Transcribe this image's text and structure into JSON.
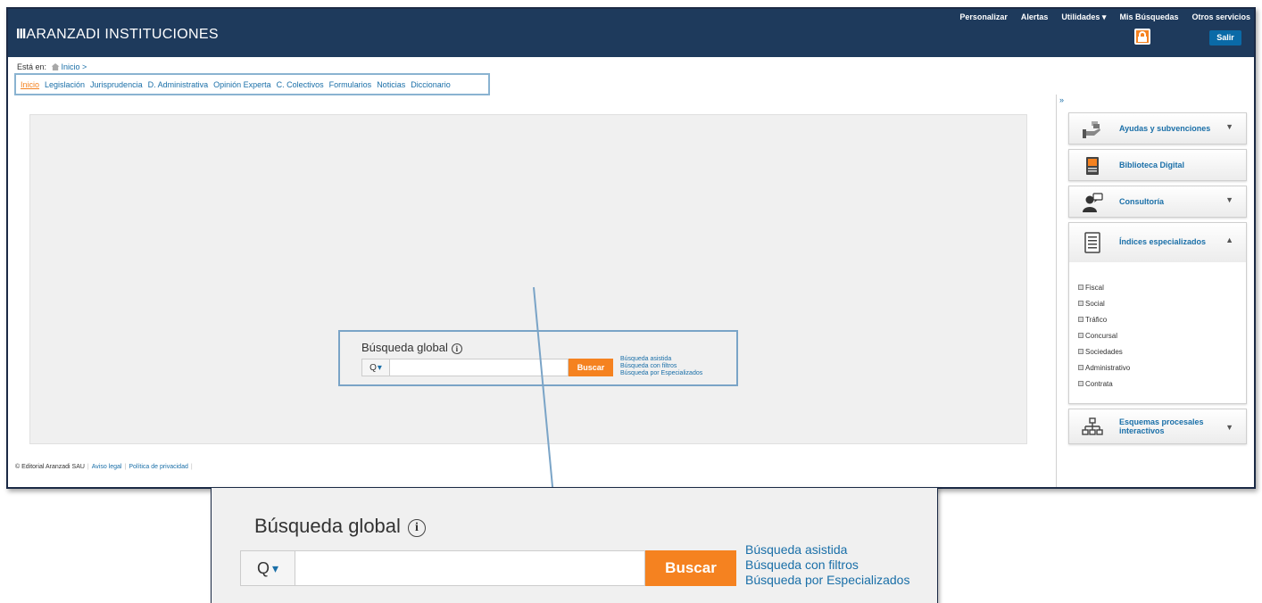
{
  "app": {
    "brand_bars": "III",
    "brand_name": "ARANZADI INSTITUCIONES"
  },
  "topnav": {
    "items": [
      "Personalizar",
      "Alertas",
      "Utilidades ▾",
      "Mis Búsquedas",
      "Otros servicios"
    ],
    "exit_label": "Salir"
  },
  "breadcrumb": {
    "prefix": "Está en:",
    "home": "Inicio >"
  },
  "mainnav": {
    "items": [
      "Inicio",
      "Legislación",
      "Jurisprudencia",
      "D. Administrativa",
      "Opinión Experta",
      "C. Colectivos",
      "Formularios",
      "Noticias",
      "Diccionario"
    ],
    "active": "Inicio"
  },
  "search": {
    "title": "Búsqueda global",
    "info": "i",
    "type_icon": "Q",
    "caret": "▾",
    "query": "",
    "button": "Buscar",
    "links": [
      "Búsqueda asistida",
      "Búsqueda con filtros",
      "Búsqueda por Especializados"
    ]
  },
  "footer": {
    "copyright": "© Editorial Aranzadi SAU",
    "links": [
      "Aviso legal",
      "Política de privacidad"
    ],
    "separator": "|"
  },
  "sidebar": {
    "collapse": "»",
    "panels": [
      {
        "label": "Ayudas y subvenciones",
        "chevron": "▼"
      },
      {
        "label": "Biblioteca Digital",
        "chevron": ""
      },
      {
        "label": "Consultoría",
        "chevron": "▼"
      }
    ],
    "indices": {
      "label": "Índices especializados",
      "chevron": "▲",
      "items": [
        "Fiscal",
        "Social",
        "Tráfico",
        "Concursal",
        "Sociedades",
        "Administrativo",
        "Contrata"
      ]
    },
    "schema": {
      "label_line1": "Esquemas procesales",
      "label_line2": "interactivos",
      "chevron": "▼"
    }
  },
  "colors": {
    "header": "#1e3a5c",
    "accent": "#f58220",
    "link": "#1a6fa8",
    "frame_highlight": "#7aa4c7"
  }
}
